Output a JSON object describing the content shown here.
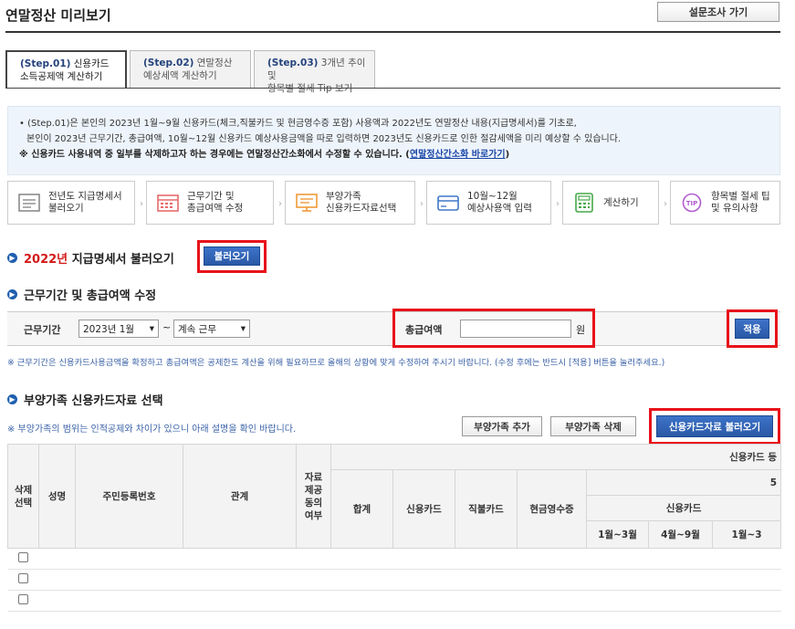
{
  "header": {
    "title": "연말정산 미리보기",
    "survey_button": "설문조사 가기"
  },
  "tabs": [
    {
      "step": "(Step.01)",
      "line1": "신용카드",
      "line2": "소득공제액 계산하기",
      "active": true
    },
    {
      "step": "(Step.02)",
      "line1": "연말정산",
      "line2": "예상세액 계산하기",
      "active": false
    },
    {
      "step": "(Step.03)",
      "line1": "3개년 추이 및",
      "line2": "항목별 절세 Tip 보기",
      "active": false
    }
  ],
  "info": {
    "line1": "• (Step.01)은 본인의 2023년 1월~9월 신용카드(체크,직불카드 및 현금영수증 포함) 사용액과 2022년도 연말정산 내용(지급명세서)를 기초로,",
    "line2": "본인이 2023년 근무기간, 총급여액, 10월~12월 신용카드 예상사용금액을 따로 입력하면 2023년도 신용카드로 인한 절감세액을 미리 예상할 수 있습니다.",
    "line3": "※ 신용카드 사용내역 중 일부를 삭제하고자 하는 경우에는 연말정산간소화에서 수정할 수 있습니다. (",
    "link": "연말정산간소화 바로가기",
    "line3_end": ")"
  },
  "process_steps": [
    {
      "line1": "전년도 지급명세서",
      "line2": "불러오기",
      "icon": "document-icon",
      "color": "#8a8a8a"
    },
    {
      "line1": "근무기간 및",
      "line2": "총급여액 수정",
      "icon": "calendar-icon",
      "color": "#e86a6a"
    },
    {
      "line1": "부양가족",
      "line2": "신용카드자료선택",
      "icon": "monitor-icon",
      "color": "#f09a3a"
    },
    {
      "line1": "10월~12월",
      "line2": "예상사용액 입력",
      "icon": "card-icon",
      "color": "#3f78c8"
    },
    {
      "line1": "계산하기",
      "line2": "",
      "icon": "calculator-icon",
      "color": "#46a84a"
    },
    {
      "line1": "항목별 절세 팁",
      "line2": "및 유의사항",
      "icon": "tip-icon",
      "color": "#b15bd0"
    }
  ],
  "section1": {
    "year": "2022년",
    "title": "지급명세서 불러오기",
    "button": "불러오기"
  },
  "section2": {
    "title": "근무기간 및 총급여액 수정",
    "period_label": "근무기간",
    "start_value": "2023년 1월",
    "tilde": "~",
    "end_value": "계속 근무",
    "salary_label": "총급여액",
    "salary_value": "",
    "unit": "원",
    "apply_button": "적용",
    "note": "※ 근무기간은 신용카드사용금액을 확정하고 총급여액은 공제한도 계산을 위해 필요하므로 올해의 상황에 맞게 수정하여 주시기 바랍니다. (수정 후에는 반드시 [적용] 버튼을 눌러주세요.)"
  },
  "section3": {
    "title": "부양가족 신용카드자료 선택",
    "note": "※ 부양가족의 범위는 인적공제와 차이가 있으니 아래 설명을 확인 바랍니다.",
    "add_button": "부양가족 추가",
    "delete_button": "부양가족 삭제",
    "load_button": "신용카드자료 불러오기"
  },
  "table": {
    "col_delete": "삭제\n선택",
    "col_name": "성명",
    "col_rrn": "주민등록번호",
    "col_relation": "관계",
    "col_provided": "자료\n제공\n동의\n여부",
    "col_group": "신용카드 등",
    "col_total": "합계",
    "col_credit": "신용카드",
    "col_debit": "직불카드",
    "col_cash": "현금영수증",
    "col_sub_5": "5",
    "col_sub_credit": "신용카드",
    "col_m1": "1월~3월",
    "col_m2": "4월~9월",
    "col_m3": "1월~3"
  }
}
